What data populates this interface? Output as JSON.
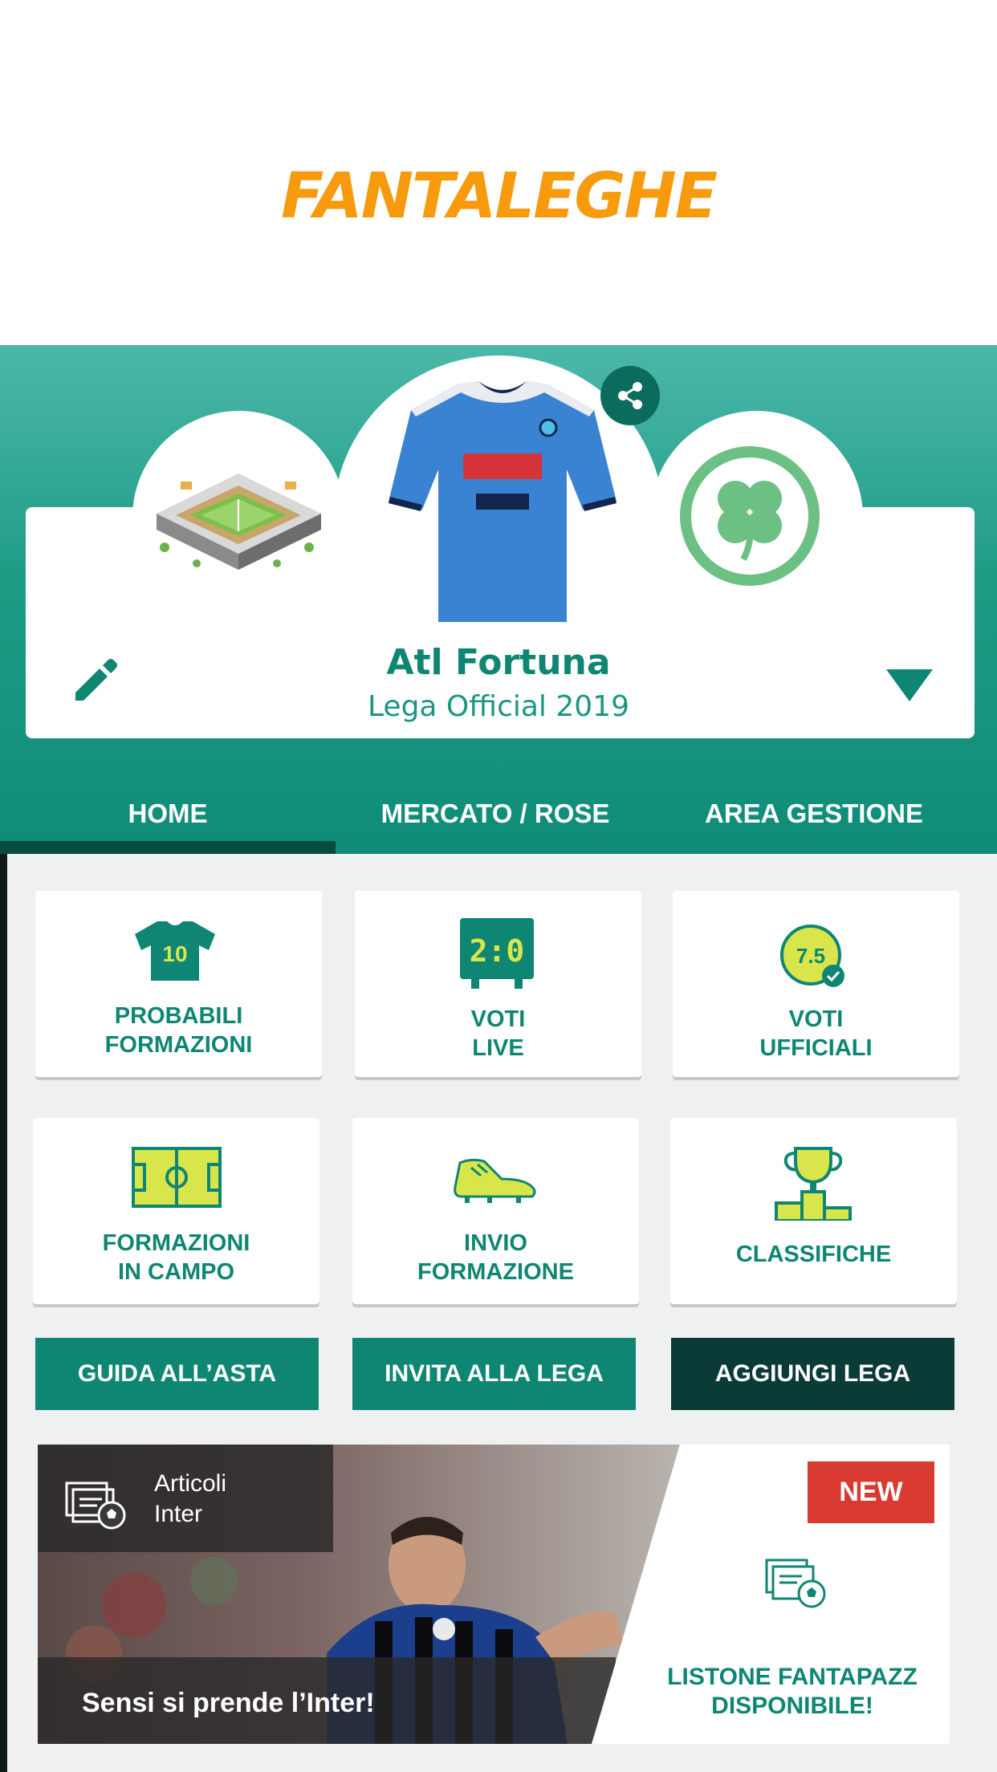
{
  "app": {
    "logo_text": "FANTALEGHE",
    "brand_color": "#f79a0e",
    "accent_color": "#0e8673"
  },
  "team": {
    "name": "Atl Fortuna",
    "league": "Lega Official 2019",
    "icons": {
      "stadium": "stadium-icon",
      "jersey": "jersey-icon",
      "badge": "clover-badge-icon",
      "share": "share-icon",
      "edit": "pencil-icon",
      "dropdown": "triangle-down-icon"
    }
  },
  "tabs": [
    {
      "label": "HOME",
      "active": true
    },
    {
      "label": "MERCATO / ROSE",
      "active": false
    },
    {
      "label": "AREA GESTIONE",
      "active": false
    }
  ],
  "tiles": [
    {
      "label": "PROBABILI\nFORMAZIONI",
      "icon": "shirt-10-icon",
      "shirt_number": "10"
    },
    {
      "label": "VOTI\nLIVE",
      "icon": "scoreboard-icon",
      "score": "2:0"
    },
    {
      "label": "VOTI\nUFFICIALI",
      "icon": "grade-badge-icon",
      "grade": "7.5"
    },
    {
      "label": "FORMAZIONI\nIN CAMPO",
      "icon": "pitch-icon"
    },
    {
      "label": "INVIO\nFORMAZIONE",
      "icon": "boot-icon"
    },
    {
      "label": "CLASSIFICHE",
      "icon": "trophy-podium-icon"
    }
  ],
  "actions": [
    {
      "label": "GUIDA ALL’ASTA",
      "color": "#0e8673"
    },
    {
      "label": "INVITA ALLA LEGA",
      "color": "#0e8673"
    },
    {
      "label": "AGGIUNGI LEGA",
      "color": "#0a3b37"
    }
  ],
  "news": {
    "category": "Articoli\nInter",
    "headline": "Sensi si prende l’Inter!",
    "badge": "NEW",
    "promo": "LISTONE FANTAPAZZ\nDISPONIBILE!",
    "category_icon": "articles-ball-icon"
  }
}
